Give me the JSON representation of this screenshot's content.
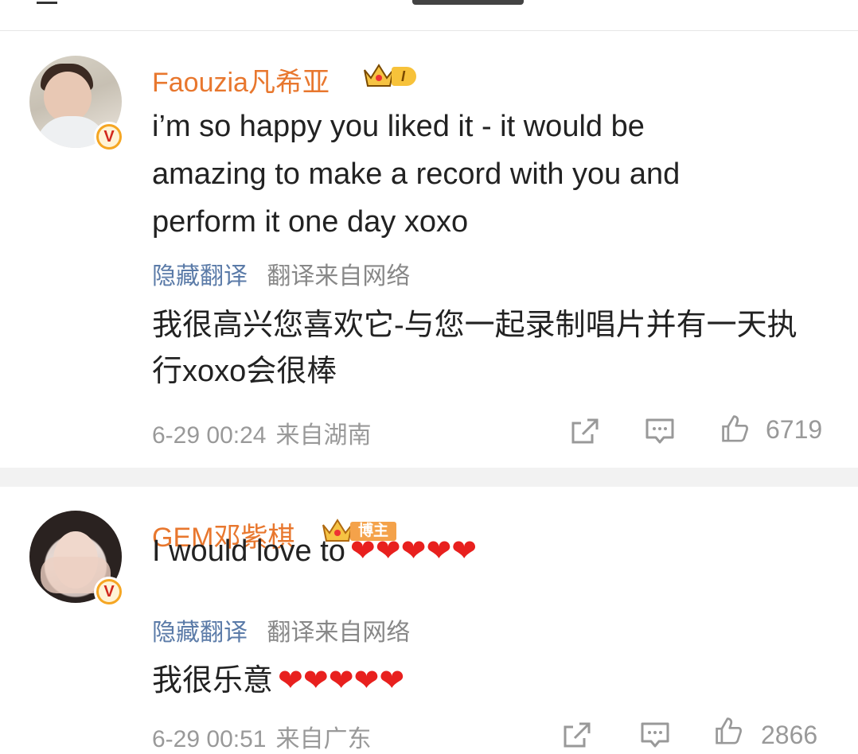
{
  "comments": [
    {
      "username": "Faouzia凡希亚",
      "level": "I",
      "original": "i’m so happy you liked it - it would be amazing to make a record with you and perform it one day xoxo",
      "hide_translation": "隐藏翻译",
      "translation_source": "翻译来自网络",
      "translation": "我很高兴您喜欢它-与您一起录制唱片并有一天执行xoxo会很棒",
      "time": "6-29 00:24",
      "location": "来自湖南",
      "likes": "6719"
    },
    {
      "username": "GEM邓紫棋",
      "level": "博主",
      "original": "I would love to",
      "hide_translation": "隐藏翻译",
      "translation_source": "翻译来自网络",
      "translation": "我很乐意",
      "hearts": "❤❤❤❤❤",
      "time": "6-29 00:51",
      "location": "来自广东",
      "likes": "2866"
    }
  ],
  "icons": {
    "verified": "verified-v-icon",
    "share": "share-icon",
    "comment": "comment-icon",
    "like": "thumbs-up-icon",
    "heart": "red-heart-emoji"
  },
  "colors": {
    "username": "#e8772e",
    "link": "#5b7ba8",
    "meta": "#999999",
    "heart": "#e8201e",
    "verified_badge": "#f5a623"
  }
}
